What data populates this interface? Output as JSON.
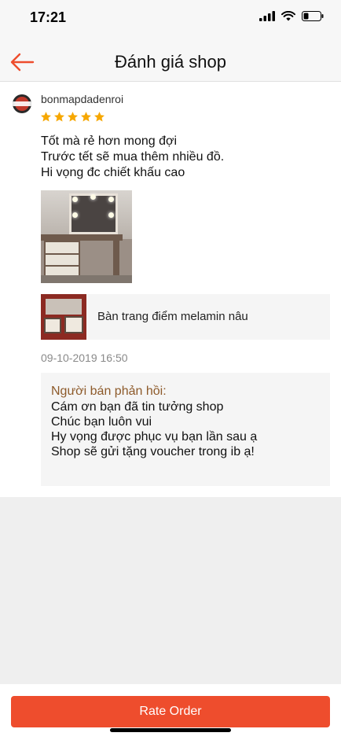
{
  "status": {
    "time": "17:21"
  },
  "header": {
    "title": "Đánh giá shop",
    "accent_color": "#ee4d2d"
  },
  "review": {
    "username": "bonmapdadenroi",
    "rating": 5,
    "lines": [
      "Tốt mà rẻ hơn mong đợi",
      "Trước tết sẽ mua thêm nhiều đồ.",
      "Hi vọng đc chiết khấu cao"
    ],
    "product_name": "Bàn trang điểm melamin nâu",
    "date": "09-10-2019 16:50",
    "seller_reply": {
      "title": "Người bán phản hồi:",
      "lines": [
        "Cám ơn bạn đã tin tưởng shop",
        "Chúc bạn luôn vui",
        "Hy vọng được phục vụ bạn lần sau ạ",
        "Shop sẽ gửi tặng voucher trong ib ạ!"
      ]
    }
  },
  "footer": {
    "button_label": "Rate Order"
  },
  "icons": {
    "back": "arrow-left-icon",
    "star": "star-icon",
    "signal": "signal-icon",
    "wifi": "wifi-icon",
    "battery": "battery-icon"
  },
  "colors": {
    "star": "#f6a700",
    "reply_title": "#8d5a2a"
  }
}
